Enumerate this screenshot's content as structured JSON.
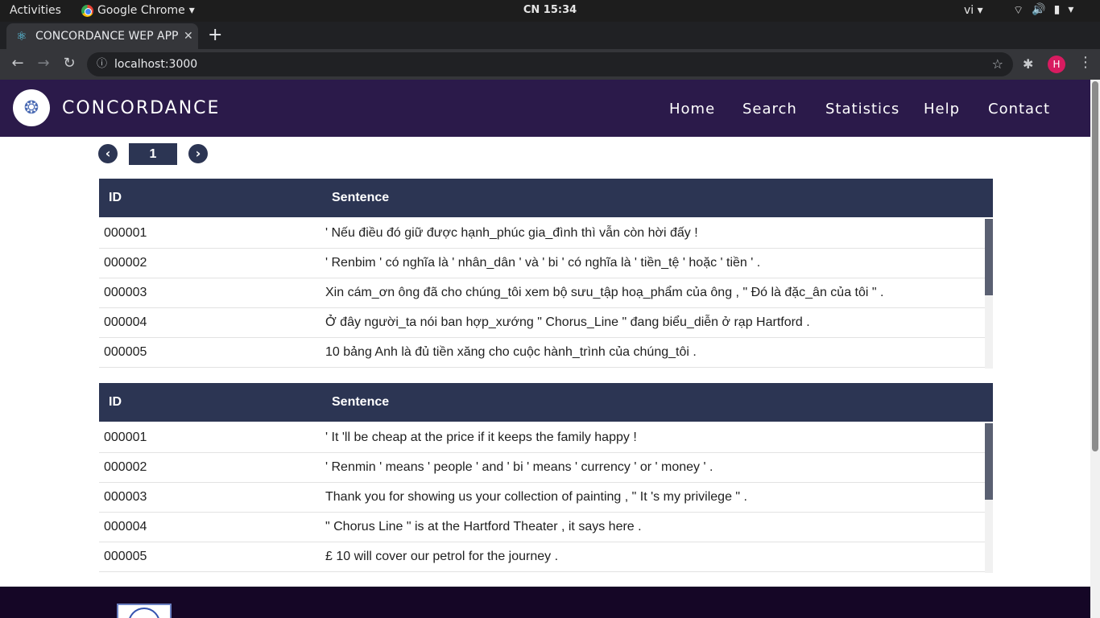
{
  "os": {
    "activities": "Activities",
    "app_name": "Google Chrome",
    "clock": "CN 15:34",
    "lang": "vi"
  },
  "browser": {
    "tab_title": "CONCORDANCE WEP APP",
    "url": "localhost:3000",
    "avatar_letter": "H"
  },
  "header": {
    "brand": "CONCORDANCE",
    "nav": [
      "Home",
      "Search",
      "Statistics",
      "Help",
      "Contact"
    ]
  },
  "pager": {
    "page": "1"
  },
  "tables": [
    {
      "col_id": "ID",
      "col_sentence": "Sentence",
      "rows": [
        {
          "id": "000001",
          "sentence": "' Nếu điều đó giữ được hạnh_phúc gia_đình thì vẫn còn hời đấy !"
        },
        {
          "id": "000002",
          "sentence": "' Renbim ' có nghĩa là ' nhân_dân ' và ' bi ' có nghĩa là ' tiền_tệ ' hoặc ' tiền ' ."
        },
        {
          "id": "000003",
          "sentence": "Xin cám_ơn ông đã cho chúng_tôi xem bộ sưu_tập hoạ_phẩm của ông , \" Đó là đặc_ân của tôi \" ."
        },
        {
          "id": "000004",
          "sentence": "Ở đây người_ta nói ban hợp_xướng \" Chorus_Line \" đang biểu_diễn ở rạp Hartford ."
        },
        {
          "id": "000005",
          "sentence": "10 bảng Anh là đủ tiền xăng cho cuộc hành_trình của chúng_tôi ."
        }
      ]
    },
    {
      "col_id": "ID",
      "col_sentence": "Sentence",
      "rows": [
        {
          "id": "000001",
          "sentence": "' It 'll be cheap at the price if it keeps the family happy !"
        },
        {
          "id": "000002",
          "sentence": "' Renmin ' means ' people ' and ' bi ' means ' currency ' or ' money ' ."
        },
        {
          "id": "000003",
          "sentence": "Thank you for showing us your collection of painting , \" It 's my privilege \" ."
        },
        {
          "id": "000004",
          "sentence": "\" Chorus Line \" is at the Hartford Theater , it says here ."
        },
        {
          "id": "000005",
          "sentence": "£ 10 will cover our petrol for the journey ."
        }
      ]
    }
  ],
  "colors": {
    "header_bg": "#2b1a4a",
    "table_head": "#2c3553",
    "footer_bg": "#150626"
  }
}
